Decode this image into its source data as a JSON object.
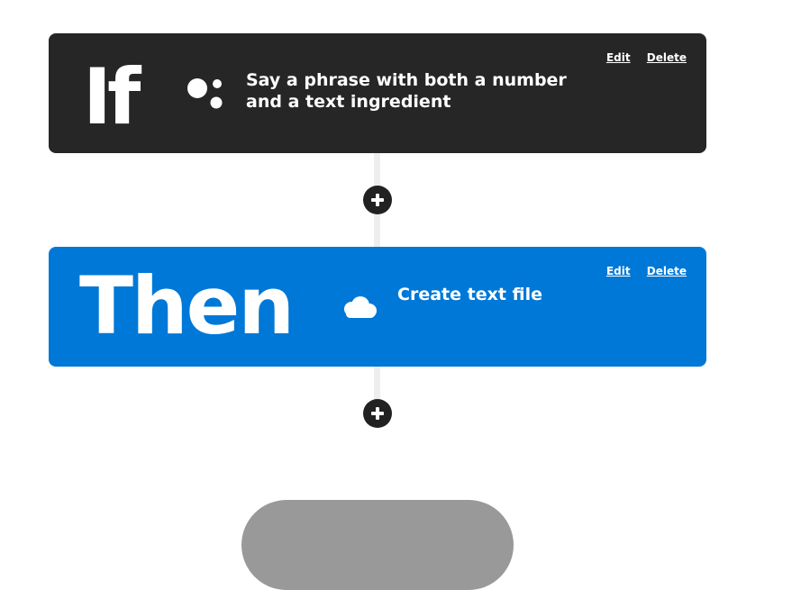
{
  "trigger": {
    "keyword": "If",
    "description": "Say a phrase with both a number and a text ingredient",
    "icon": "google-assistant-icon",
    "edit_label": "Edit",
    "delete_label": "Delete",
    "background": "#262626"
  },
  "action": {
    "keyword": "Then",
    "description": "Create text file",
    "icon": "onedrive-cloud-icon",
    "edit_label": "Edit",
    "delete_label": "Delete",
    "background": "#0078d7"
  },
  "colors": {
    "connector": "#eeeeee",
    "add_button": "#222222",
    "bottom_button": "#999999"
  }
}
